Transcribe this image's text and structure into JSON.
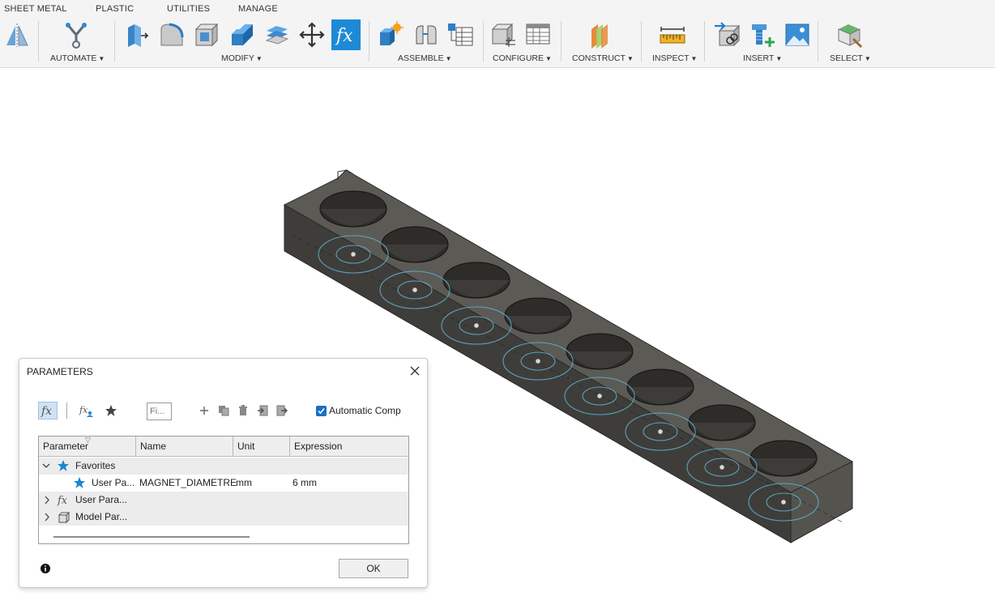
{
  "toolbar": {
    "tabs": [
      "SHEET METAL",
      "PLASTIC",
      "UTILITIES",
      "MANAGE"
    ],
    "groups": {
      "automate": "AUTOMATE",
      "modify": "MODIFY",
      "assemble": "ASSEMBLE",
      "configure": "CONFIGURE",
      "construct": "CONSTRUCT",
      "inspect": "INSPECT",
      "insert": "INSERT",
      "select": "SELECT"
    },
    "active_tool": "change-parameters-icon",
    "accent": "#1e8ad6"
  },
  "dialog": {
    "title": "PARAMETERS",
    "filter_placeholder": "Fi...",
    "automatic_compute": {
      "label": "Automatic Comp",
      "checked": true
    },
    "columns": [
      "Parameter",
      "Name",
      "Unit",
      "Expression"
    ],
    "rows": [
      {
        "type": "group",
        "label": "Favorites",
        "icon": "star-icon",
        "expanded": true
      },
      {
        "type": "param",
        "parameter": "User Pa...",
        "name": "MAGNET_DIAMETRE",
        "unit": "mm",
        "expression": "6 mm",
        "icon": "star-icon"
      },
      {
        "type": "group",
        "label": "User Para...",
        "icon": "fx-icon",
        "expanded": false
      },
      {
        "type": "group",
        "label": "Model Par...",
        "icon": "cube-icon",
        "expanded": false
      }
    ],
    "ok_label": "OK"
  },
  "model": {
    "description_icons": "magnet-holder",
    "hole_count": 8
  }
}
